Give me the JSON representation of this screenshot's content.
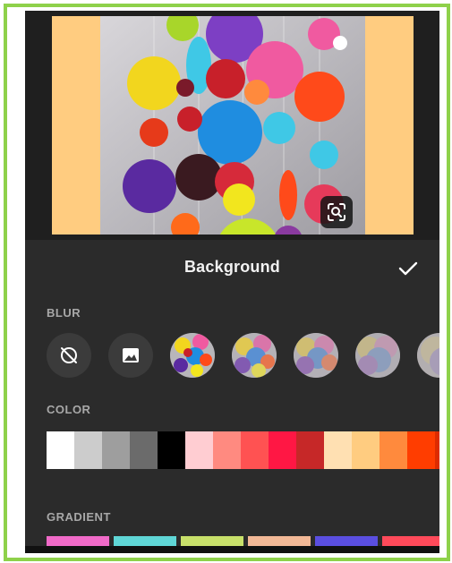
{
  "panel": {
    "title": "Background",
    "confirm_icon": "checkmark-icon"
  },
  "sections": {
    "blur": "BLUR",
    "color": "COLOR",
    "gradient": "GRADIENT"
  },
  "blur_options": [
    {
      "name": "no-blur",
      "icon": "no-blur-icon"
    },
    {
      "name": "image",
      "icon": "image-icon"
    },
    {
      "name": "blur-level-1"
    },
    {
      "name": "blur-level-2"
    },
    {
      "name": "blur-level-3"
    },
    {
      "name": "blur-level-4"
    },
    {
      "name": "blur-level-5"
    }
  ],
  "colors": [
    "#ffffff",
    "#cccccc",
    "#9e9e9e",
    "#6b6b6b",
    "#000000",
    "#ffcdd2",
    "#ff8a80",
    "#ff5252",
    "#ff1744",
    "#c62828",
    "#ffe0b2",
    "#ffcc80",
    "#ff8a3d",
    "#ff3d00",
    "#dd2c00"
  ],
  "gradients": [
    "#f06ac8",
    "#5fd6d6",
    "#c8e06a",
    "#f2b896",
    "#5a4ee0",
    "#ff4a5a"
  ],
  "accent": {
    "frame": "#8ed14a",
    "canvas_bg": "#ffcc80"
  }
}
